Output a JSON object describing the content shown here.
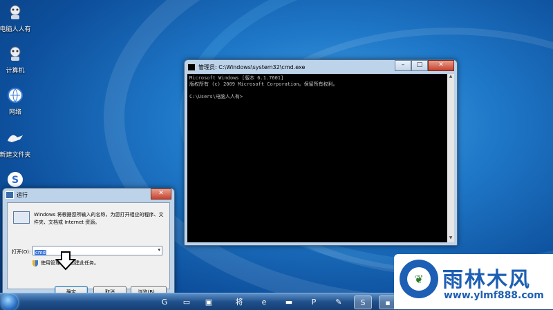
{
  "desktop": {
    "icons": [
      {
        "label": "电脑人人有",
        "icon": "user-folder-icon"
      },
      {
        "label": "计算机",
        "icon": "computer-icon"
      },
      {
        "label": "网络",
        "icon": "network-icon"
      },
      {
        "label": "新建文件夹",
        "icon": "folder-icon"
      },
      {
        "label": "",
        "icon": "sogou-icon"
      }
    ]
  },
  "cmd_window": {
    "title": "管理员: C:\\Windows\\system32\\cmd.exe",
    "lines": [
      "Microsoft Windows [版本 6.1.7601]",
      "版权所有 (c) 2009 Microsoft Corporation。保留所有权利。",
      "",
      "C:\\Users\\电脑人人有>"
    ],
    "min_label": "–",
    "max_label": "□",
    "close_label": "✕"
  },
  "run_dialog": {
    "title": "运行",
    "close_label": "✕",
    "description": "Windows 将根据您所输入的名称，为您打开相应的程序、文件夹、文档或 Internet 资源。",
    "open_label": "打开(O):",
    "open_value": "cmd",
    "admin_text": "使用管理权限创建此任务。",
    "ok_label": "确定",
    "cancel_label": "取消",
    "browse_label": "浏览(B)..."
  },
  "taskbar": {
    "items": [
      {
        "name": "app-g-icon",
        "glyph": "G"
      },
      {
        "name": "desktop-icon",
        "glyph": "▭"
      },
      {
        "name": "monitor-icon",
        "glyph": "▣"
      },
      {
        "name": "media-icon",
        "glyph": "▶"
      },
      {
        "name": "jiang-icon",
        "glyph": "将"
      },
      {
        "name": "ie-icon",
        "glyph": "e"
      },
      {
        "name": "folder-icon",
        "glyph": "▬"
      },
      {
        "name": "p-icon",
        "glyph": "P"
      },
      {
        "name": "tools-icon",
        "glyph": "✎"
      },
      {
        "name": "sogou-icon",
        "glyph": "S"
      },
      {
        "name": "cmd-icon",
        "glyph": "▪"
      },
      {
        "name": "record-icon",
        "glyph": "●"
      }
    ]
  },
  "watermark": {
    "brand": "雨林木风",
    "url": "www.ylmf888.com"
  },
  "colors": {
    "accent": "#1d5fb4",
    "selection": "#3875d7"
  }
}
